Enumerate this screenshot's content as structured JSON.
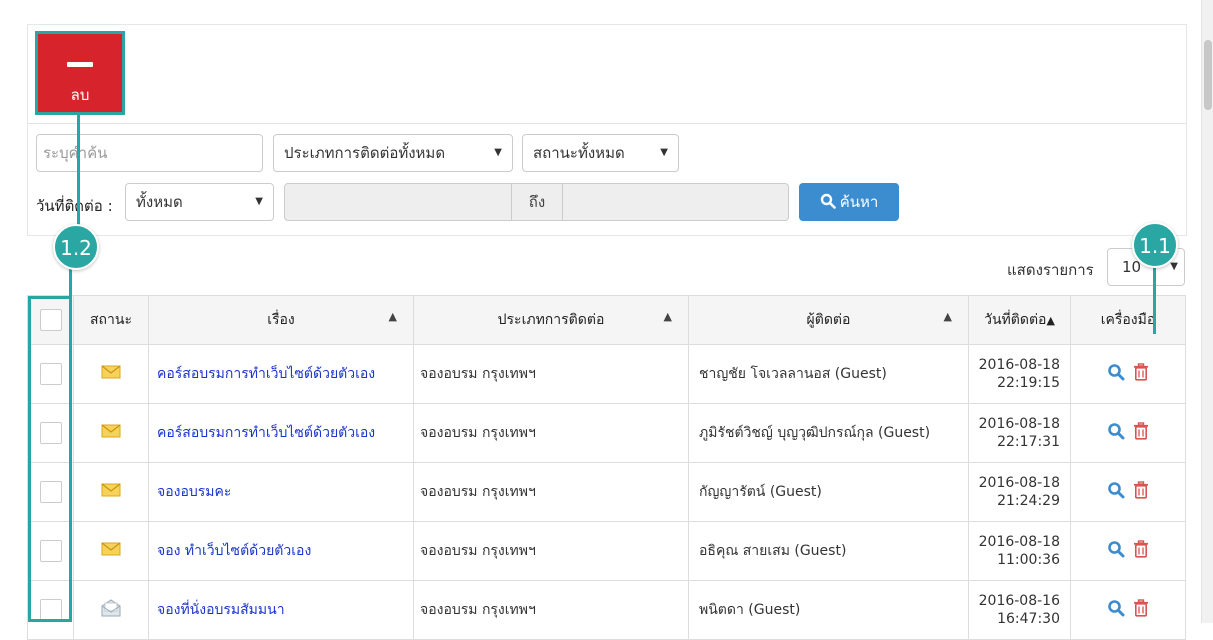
{
  "toolbar": {
    "delete_label": "ลบ"
  },
  "filters": {
    "search_placeholder": "ระบุคำค้น",
    "contact_type_value": "ประเภทการติดต่อทั้งหมด",
    "status_value": "สถานะทั้งหมด",
    "contact_date_label": "วันที่ติดต่อ :",
    "date_range_value": "ทั้งหมด",
    "date_to_label": "ถึง",
    "search_button": "ค้นหา"
  },
  "pagination": {
    "show_label": "แสดงรายการ",
    "show_value": "10"
  },
  "table": {
    "headers": {
      "status": "สถานะ",
      "subject": "เรื่อง",
      "contact_type": "ประเภทการติดต่อ",
      "contact": "ผู้ติดต่อ",
      "contact_date": "วันที่ติดต่อ",
      "tools": "เครื่องมือ"
    },
    "rows": [
      {
        "status_icon": "envelope-unread-icon",
        "subject": "คอร์สอบรมการทำเว็บไซต์ด้วยตัวเอง",
        "contact_type": "จองอบรม กรุงเทพฯ",
        "contact": "ชาญชัย โจเวลลานอส (Guest)",
        "date": "2016-08-18",
        "time": "22:19:15"
      },
      {
        "status_icon": "envelope-unread-icon",
        "subject": "คอร์สอบรมการทำเว็บไซต์ด้วยตัวเอง",
        "contact_type": "จองอบรม กรุงเทพฯ",
        "contact": "ภูมิรัชต์วิชญ์ บุญวุฒิปกรณ์กุล (Guest)",
        "date": "2016-08-18",
        "time": "22:17:31"
      },
      {
        "status_icon": "envelope-unread-icon",
        "subject": "จองอบรมคะ",
        "contact_type": "จองอบรม กรุงเทพฯ",
        "contact": "กัญญารัตน์ (Guest)",
        "date": "2016-08-18",
        "time": "21:24:29"
      },
      {
        "status_icon": "envelope-unread-icon",
        "subject": "จอง ทำเว็บไซต์ด้วยตัวเอง",
        "contact_type": "จองอบรม กรุงเทพฯ",
        "contact": "อธิคุณ สายเสม (Guest)",
        "date": "2016-08-18",
        "time": "11:00:36"
      },
      {
        "status_icon": "envelope-read-icon",
        "subject": "จองที่นั่งอบรมสัมมนา",
        "contact_type": "จองอบรม กรุงเทพฯ",
        "contact": "พนิตดา (Guest)",
        "date": "2016-08-16",
        "time": "16:47:30"
      }
    ]
  },
  "annotations": {
    "callout_1": "1.1",
    "callout_2": "1.2"
  },
  "colors": {
    "delete_button": "#d7232b",
    "search_button": "#3c8dd0",
    "annotation": "#29a6a4",
    "link": "#1a35cc",
    "trash_icon": "#d9534f",
    "search_icon": "#3c8dd0"
  }
}
